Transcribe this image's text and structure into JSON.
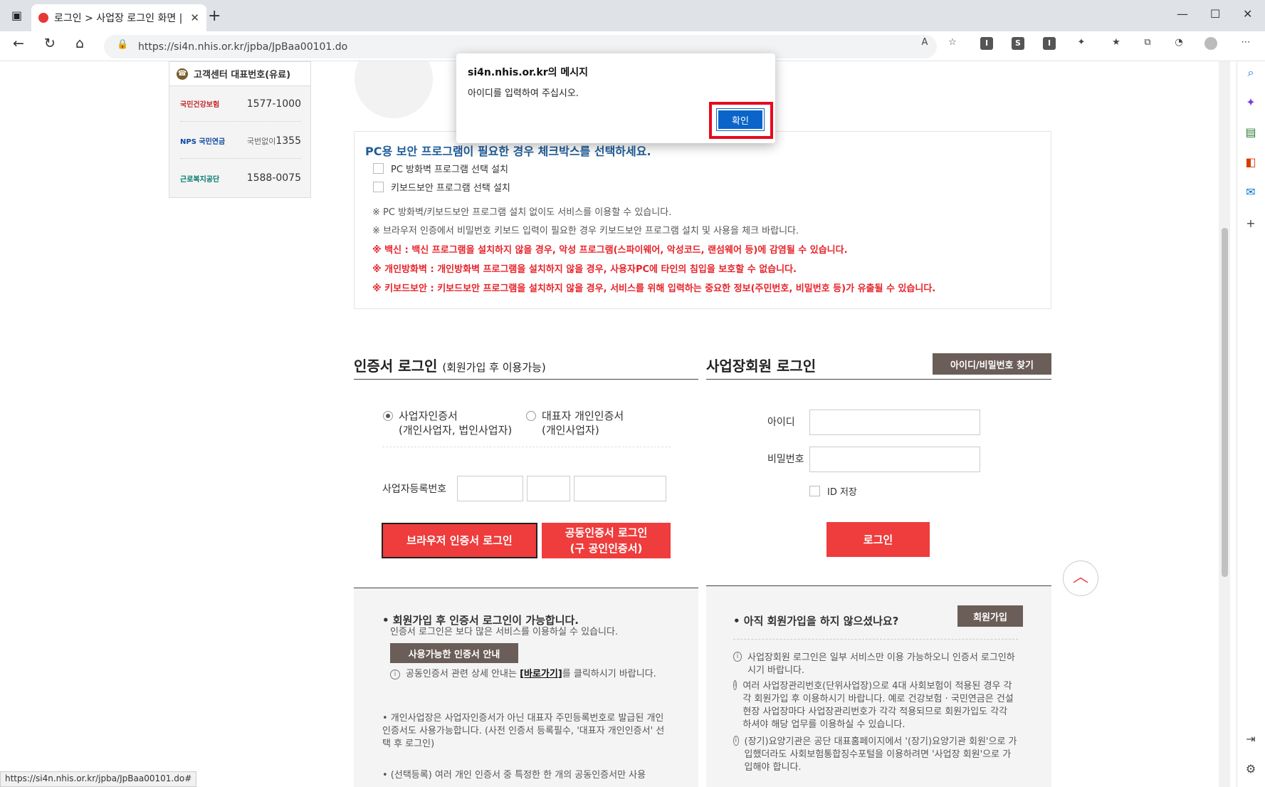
{
  "browser": {
    "tab_title": "로그인 > 사업장 로그인 화면 | h",
    "url": "https://si4n.nhis.or.kr/jpba/JpBaa00101.do",
    "status_url": "https://si4n.nhis.or.kr/jpba/JpBaa00101.do#"
  },
  "customer_center": {
    "title": "고객센터 대표번호(유료)",
    "rows": [
      {
        "logo": "국민건강보험",
        "number": "1577-1000"
      },
      {
        "logo": "NPS 국민연금",
        "prefix": "국번없이",
        "number": "1355"
      },
      {
        "logo": "근로복지공단",
        "number": "1588-0075"
      }
    ]
  },
  "security": {
    "title": "PC용 보안 프로그램이 필요한 경우 체크박스를 선택하세요.",
    "options": [
      "PC 방화벽 프로그램 선택 설치",
      "키보드보안 프로그램 선택 설치"
    ],
    "notes": [
      "※ PC 방화벽/키보드보안 프로그램 설치 없이도 서비스를 이용할 수 있습니다.",
      "※ 브라우저 인증에서 비밀번호 키보드 입력이 필요한 경우 키보드보안 프로그램 설치 및 사용을 체크 바랍니다."
    ],
    "warnings": [
      "※ 백신 : 백신 프로그램을 설치하지 않을 경우, 악성 프로그램(스파이웨어, 악성코드, 랜섬웨어 등)에 감염될 수 있습니다.",
      "※ 개인방화벽 : 개인방화벽 프로그램을 설치하지 않을 경우, 사용자PC에 타인의 침입을 보호할 수 없습니다.",
      "※ 키보드보안 : 키보드보안 프로그램을 설치하지 않을 경우, 서비스를 위해 입력하는 중요한 정보(주민번호, 비밀번호 등)가 유출될 수 있습니다."
    ]
  },
  "cert_login": {
    "title": "인증서 로그인",
    "subtitle": "(회원가입 후 이용가능)",
    "radio1": {
      "label": "사업자인증서",
      "sub": "(개인사업자, 법인사업자)",
      "selected": true
    },
    "radio2": {
      "label": "대표자 개인인증서",
      "sub": "(개인사업자)",
      "selected": false
    },
    "bizno_label": "사업자등록번호",
    "browser_btn": "브라우저 인증서 로그인",
    "joint_btn_line1": "공동인증서 로그인",
    "joint_btn_line2": "(구 공인인증서)",
    "info_title": "• 회원가입 후 인증서 로그인이 가능합니다.",
    "info_sub": "인증서 로그인은 보다 많은 서비스를 이용하실 수 있습니다.",
    "cert_guide_btn": "사용가능한 인증서 안내",
    "info_link_pre": "공동인증서 관련 상세 안내는 ",
    "info_link": "[바로가기]",
    "info_link_post": "를 클릭하시기 바랍니다.",
    "info2": "• 개인사업장은 사업자인증서가 아닌 대표자 주민등록번호로 발급된 개인인증서도 사용가능합니다. (사전 인증서 등록필수, '대표자 개인인증서' 선택 후 로그인)",
    "info3": "• (선택등록) 여러 개인 인증서 중 특정한 한 개의 공동인증서만 사용"
  },
  "member_login": {
    "title": "사업장회원 로그인",
    "find_btn": "아이디/비밀번호 찾기",
    "id_label": "아이디",
    "pw_label": "비밀번호",
    "save_id": "ID 저장",
    "login_btn": "로그인",
    "join_q": "• 아직 회원가입을 하지 않으셨나요?",
    "join_btn": "회원가입",
    "notes": [
      "사업장회원 로그인은 일부 서비스만 이용 가능하오니 인증서 로그인하시기 바랍니다.",
      "여러 사업장관리번호(단위사업장)으로 4대 사회보험이 적용된 경우 각각 회원가입 후 이용하시기 바랍니다. 예로 건강보험 · 국민연금은 건설현장 사업장마다 사업장관리번호가 각각 적용되므로 회원가입도 각각 하셔야 해당 업무를 이용하실 수 있습니다.",
      "(장기)요양기관은 공단 대표홈페이지에서 '(장기)요양기관 회원'으로 가입했더라도 사회보험통합징수포털을 이용하려면 '사업장 회원'으로 가입해야 합니다."
    ]
  },
  "dialog": {
    "title": "si4n.nhis.or.kr의 메시지",
    "message": "아이디를 입력하여 주십시오.",
    "ok": "확인"
  },
  "colors": {
    "accent_red": "#ef3c3c",
    "brown_btn": "#6b5d58",
    "dialog_blue": "#0a64c9",
    "highlight": "#e8091e"
  }
}
